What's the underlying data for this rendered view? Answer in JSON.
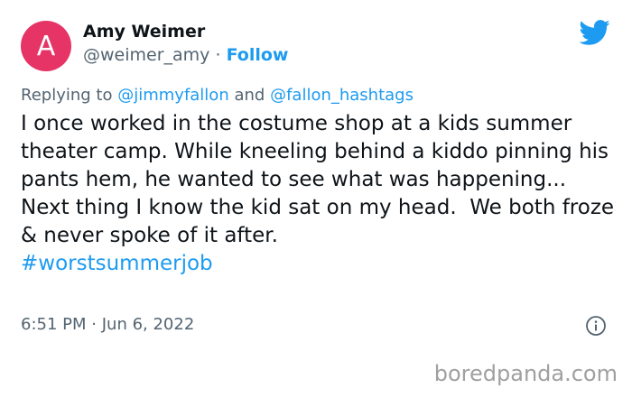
{
  "author": {
    "avatar_initial": "A",
    "avatar_color": "#e53465",
    "name": "Amy Weimer",
    "handle": "@weimer_amy",
    "separator": "·",
    "follow_label": "Follow"
  },
  "reply": {
    "prefix": "Replying to",
    "mention_1": "@jimmyfallon",
    "conjunction": "and",
    "mention_2": "@fallon_hashtags"
  },
  "tweet": {
    "text": "I once worked in the costume shop at a kids summer theater camp. While kneeling behind a kiddo pinning his pants hem, he wanted to see what was happening... Next thing I know the kid sat on my head.  We both froze & never spoke of it after.",
    "hashtag": "#worstsummerjob"
  },
  "meta": {
    "time": "6:51 PM",
    "separator": "·",
    "date": "Jun 6, 2022"
  },
  "icons": {
    "logo": "twitter-bird-icon",
    "info": "info-icon"
  },
  "watermark": "boredpanda.com",
  "colors": {
    "link": "#1d9bf0",
    "secondary_text": "#536471",
    "twitter_blue": "#1d9bf0"
  }
}
